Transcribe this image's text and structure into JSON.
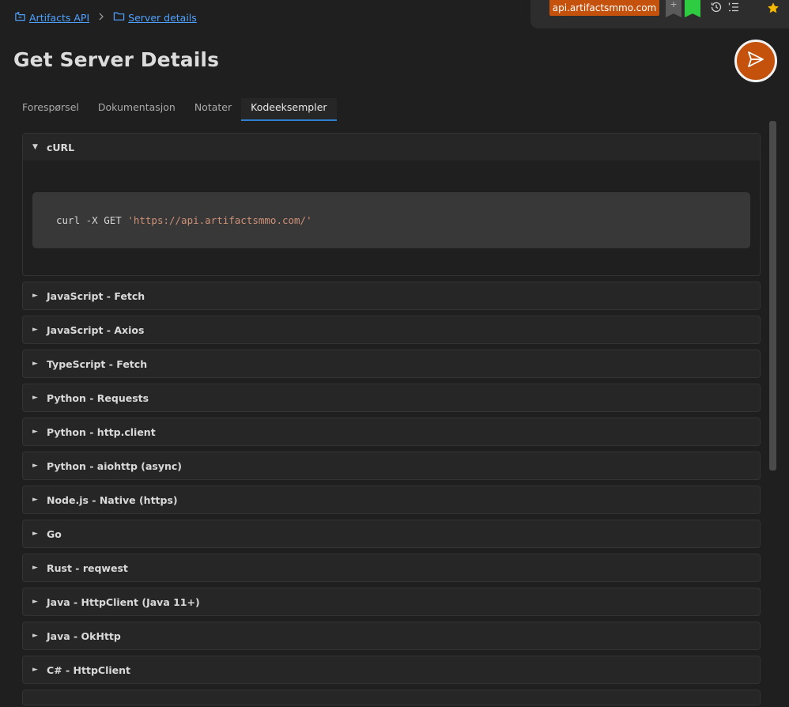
{
  "breadcrumb": {
    "root_label": "Artifacts API",
    "separator": ">",
    "current_label": "Server details"
  },
  "toolbar": {
    "domain": "api.artifactsmmo.com",
    "gray_flag_symbol": "+",
    "history_icon": "history-icon",
    "list_icon": "numbered-list-icon",
    "star_icon": "star-icon"
  },
  "page": {
    "title": "Get Server Details"
  },
  "tabs": [
    {
      "label": "Forespørsel",
      "active": false
    },
    {
      "label": "Dokumentasjon",
      "active": false
    },
    {
      "label": "Notater",
      "active": false
    },
    {
      "label": "Kodeeksempler",
      "active": true
    }
  ],
  "sections": [
    {
      "label": "cURL",
      "open": true
    },
    {
      "label": "JavaScript - Fetch",
      "open": false
    },
    {
      "label": "JavaScript - Axios",
      "open": false
    },
    {
      "label": "TypeScript - Fetch",
      "open": false
    },
    {
      "label": "Python - Requests",
      "open": false
    },
    {
      "label": "Python - http.client",
      "open": false
    },
    {
      "label": "Python - aiohttp (async)",
      "open": false
    },
    {
      "label": "Node.js - Native (https)",
      "open": false
    },
    {
      "label": "Go",
      "open": false
    },
    {
      "label": "Rust - reqwest",
      "open": false
    },
    {
      "label": "Java - HttpClient (Java 11+)",
      "open": false
    },
    {
      "label": "Java - OkHttp",
      "open": false
    },
    {
      "label": "C# - HttpClient",
      "open": false
    }
  ],
  "curl_code": {
    "command": "curl -X GET ",
    "url": "'https://api.artifactsmmo.com/'"
  },
  "arrows": {
    "open": "▼",
    "closed": "►"
  },
  "colors": {
    "accent": "#c4520c",
    "link": "#4ea1ff",
    "active_tab_underline": "#2f7fd1",
    "green_flag": "#2ecc40",
    "star": "#f5b800"
  }
}
